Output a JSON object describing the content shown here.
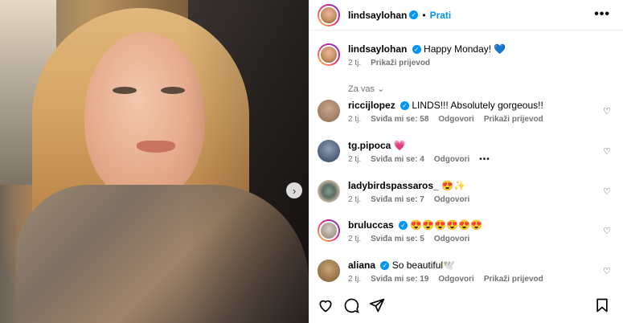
{
  "post": {
    "username": "lindsaylohan",
    "follow_label": "Prati",
    "separator": "•",
    "caption": "Happy Monday! 💙",
    "caption_time": "2 tj.",
    "translate_label": "Prikaži prijevod"
  },
  "comments_filter": "Za vas",
  "comments": [
    {
      "username": "riccijlopez",
      "verified": true,
      "text": "LINDS!!! Absolutely gorgeous!!",
      "time": "2 tj.",
      "likes": "Sviđa mi se: 58",
      "reply": "Odgovori",
      "translate": "Prikaži prijevod",
      "more": ""
    },
    {
      "username": "tg.pipoca",
      "verified": false,
      "text": "💗",
      "time": "2 tj.",
      "likes": "Sviđa mi se: 4",
      "reply": "Odgovori",
      "translate": "",
      "more": "•••"
    },
    {
      "username": "ladybirdspassaros_",
      "verified": false,
      "text": "😍✨",
      "time": "2 tj.",
      "likes": "Sviđa mi se: 7",
      "reply": "Odgovori",
      "translate": "",
      "more": ""
    },
    {
      "username": "bruluccas",
      "verified": true,
      "text": "😍😍😍😍😍😍",
      "time": "2 tj.",
      "likes": "Sviđa mi se: 5",
      "reply": "Odgovori",
      "translate": "",
      "more": ""
    },
    {
      "username": "aliana",
      "verified": true,
      "text": "So beautiful🕊️",
      "time": "2 tj.",
      "likes": "Sviđa mi se: 19",
      "reply": "Odgovori",
      "translate": "Prikaži prijevod",
      "more": ""
    }
  ],
  "icons": {
    "next": "›",
    "more": "•••",
    "check": "✓",
    "heart": "♡",
    "chevron": "⌄"
  },
  "colors": {
    "accent": "#0095f6",
    "muted": "#737373"
  }
}
